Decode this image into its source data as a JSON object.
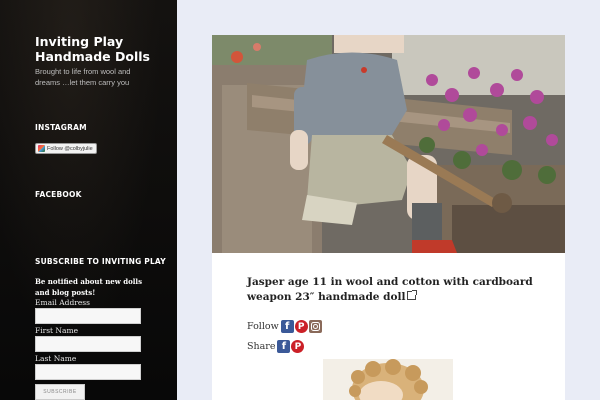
{
  "site": {
    "title": "Inviting Play Handmade Dolls",
    "tagline": "Brought to life from wool and dreams …let them carry you"
  },
  "widgets": {
    "instagram": {
      "title": "INSTAGRAM",
      "follow_label": "Follow @colbyjulie"
    },
    "facebook": {
      "title": "FACEBOOK"
    },
    "subscribe": {
      "title": "SUBSCRIBE TO INVITING PLAY",
      "description": "Be notified about new dolls and blog posts!",
      "email_label": "Email Address",
      "first_name_label": "First Name",
      "last_name_label": "Last Name",
      "email_value": "",
      "first_name_value": "",
      "last_name_value": "",
      "button_label": "SUBSCRIBE"
    }
  },
  "post": {
    "title": "Jasper age 11 in wool and cotton with cardboard weapon 23″ handmade doll",
    "follow_label": "Follow",
    "share_label": "Share",
    "follow_icons": [
      "facebook-icon",
      "pinterest-icon",
      "instagram-icon"
    ],
    "share_icons": [
      "facebook-icon",
      "pinterest-icon"
    ]
  },
  "colors": {
    "sidebar_bg": "#0b0b0b",
    "page_bg": "#e9ecf6",
    "facebook": "#3b5998",
    "pinterest": "#cb2027"
  }
}
